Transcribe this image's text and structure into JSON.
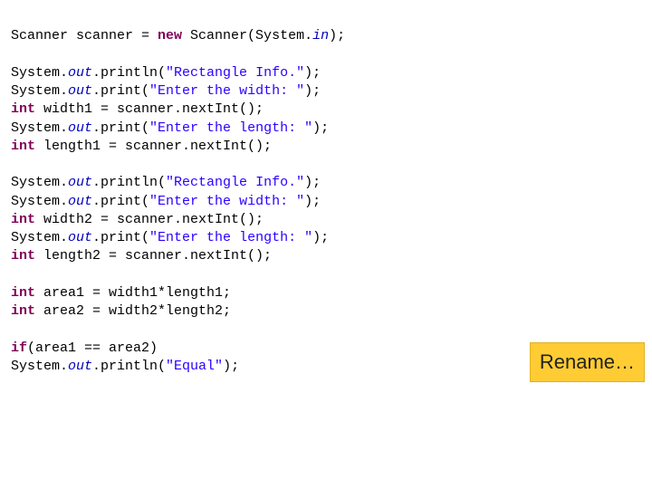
{
  "code": {
    "block1": {
      "l1": {
        "a": "Scanner scanner = ",
        "kw": "new",
        "b": " Scanner(System.",
        "field": "in",
        "c": ");"
      }
    },
    "block2": {
      "l1": {
        "a": "System.",
        "field": "out",
        "b": ".println(",
        "str": "\"Rectangle Info.\"",
        "c": ");"
      },
      "l2": {
        "a": "System.",
        "field": "out",
        "b": ".print(",
        "str": "\"Enter the width: \"",
        "c": ");"
      },
      "l3": {
        "kw": "int",
        "a": " width1 = scanner.nextInt();"
      },
      "l4": {
        "a": "System.",
        "field": "out",
        "b": ".print(",
        "str": "\"Enter the length: \"",
        "c": ");"
      },
      "l5": {
        "kw": "int",
        "a": " length1 = scanner.nextInt();"
      }
    },
    "block3": {
      "l1": {
        "a": "System.",
        "field": "out",
        "b": ".println(",
        "str": "\"Rectangle Info.\"",
        "c": ");"
      },
      "l2": {
        "a": "System.",
        "field": "out",
        "b": ".print(",
        "str": "\"Enter the width: \"",
        "c": ");"
      },
      "l3": {
        "kw": "int",
        "a": " width2 = scanner.nextInt();"
      },
      "l4": {
        "a": "System.",
        "field": "out",
        "b": ".print(",
        "str": "\"Enter the length: \"",
        "c": ");"
      },
      "l5": {
        "kw": "int",
        "a": " length2 = scanner.nextInt();"
      }
    },
    "block4": {
      "l1": {
        "kw": "int",
        "a": " area1 = width1*length1;"
      },
      "l2": {
        "kw": "int",
        "a": " area2 = width2*length2;"
      }
    },
    "block5": {
      "l1": {
        "kw": "if",
        "a": "(area1 == area2)"
      },
      "l2": {
        "a": "System.",
        "field": "out",
        "b": ".println(",
        "str": "\"Equal\"",
        "c": ");"
      }
    }
  },
  "callout": {
    "label": "Rename…"
  }
}
